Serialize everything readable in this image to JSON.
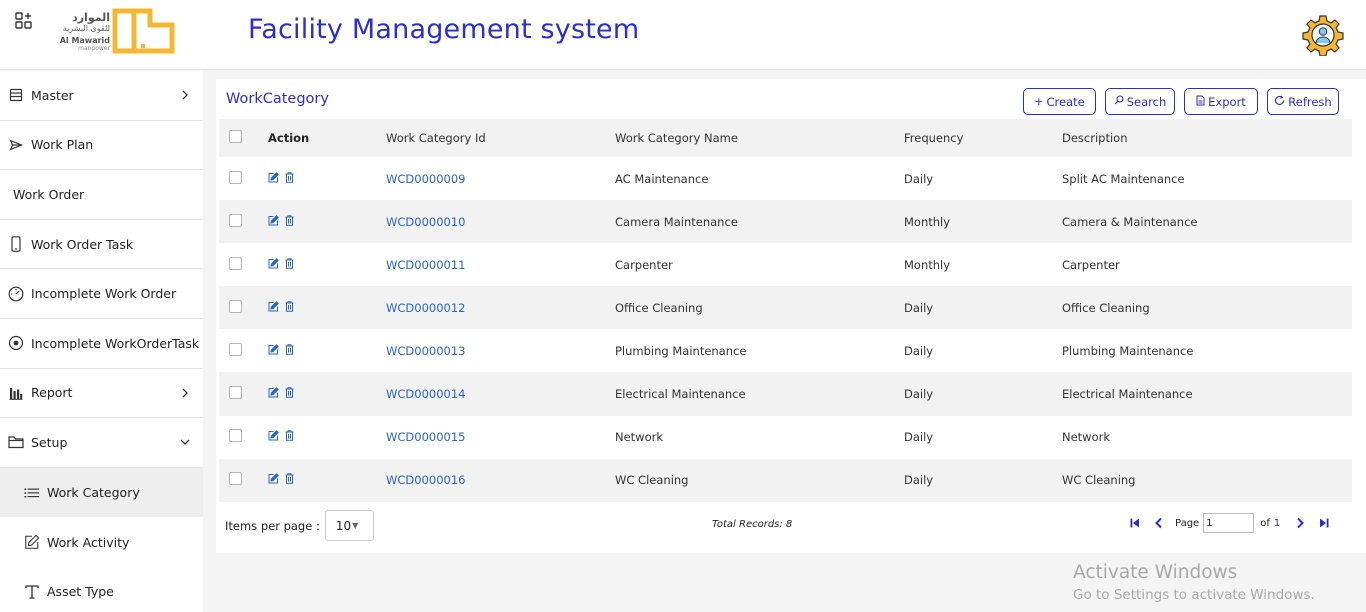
{
  "header": {
    "title": "Facility Management system",
    "logo": {
      "arabic_line1": "الموارد",
      "arabic_line2": "للقوى البشرية",
      "english": "Al Mawarid",
      "sub": "manpower"
    }
  },
  "sidebar": {
    "items": [
      {
        "label": "Master",
        "icon": "list-icon"
      },
      {
        "label": "Work Plan",
        "icon": "send-icon"
      },
      {
        "label": "Work Order"
      },
      {
        "label": "Work Order Task",
        "icon": "mobile-icon"
      },
      {
        "label": "Incomplete Work Order",
        "icon": "gauge-icon"
      },
      {
        "label": "Incomplete WorkOrderTask",
        "icon": "target-icon"
      },
      {
        "label": "Report",
        "icon": "bar-chart-icon"
      },
      {
        "label": "Setup",
        "icon": "folder-icon"
      },
      {
        "label": "Work Category",
        "icon": "list-bullets-icon"
      },
      {
        "label": "Work Activity",
        "icon": "edit-icon"
      },
      {
        "label": "Asset Type",
        "icon": "text-icon"
      }
    ]
  },
  "panel": {
    "title": "WorkCategory",
    "buttons": {
      "create": "Create",
      "search": "Search",
      "export": "Export",
      "refresh": "Refresh"
    }
  },
  "table": {
    "headers": {
      "action": "Action",
      "id": "Work Category Id",
      "name": "Work Category Name",
      "frequency": "Frequency",
      "description": "Description"
    },
    "rows": [
      {
        "id": "WCD0000009",
        "name": "AC Maintenance",
        "frequency": "Daily",
        "description": "Split AC Maintenance"
      },
      {
        "id": "WCD0000010",
        "name": "Camera Maintenance",
        "frequency": "Monthly",
        "description": "Camera & Maintenance"
      },
      {
        "id": "WCD0000011",
        "name": "Carpenter",
        "frequency": "Monthly",
        "description": "Carpenter"
      },
      {
        "id": "WCD0000012",
        "name": "Office Cleaning",
        "frequency": "Daily",
        "description": "Office Cleaning"
      },
      {
        "id": "WCD0000013",
        "name": "Plumbing Maintenance",
        "frequency": "Daily",
        "description": "Plumbing Maintenance"
      },
      {
        "id": "WCD0000014",
        "name": "Electrical Maintenance",
        "frequency": "Daily",
        "description": "Electrical Maintenance"
      },
      {
        "id": "WCD0000015",
        "name": "Network",
        "frequency": "Daily",
        "description": "Network"
      },
      {
        "id": "WCD0000016",
        "name": "WC Cleaning",
        "frequency": "Daily",
        "description": "WC Cleaning"
      }
    ]
  },
  "footer": {
    "items_per_page_label": "Items per page :",
    "items_per_page": "10",
    "total_records": "Total Records: 8",
    "page_label": "Page",
    "page_value": "1",
    "of_label": "of",
    "total_pages": "1"
  },
  "watermark": {
    "line1": "Activate Windows",
    "line2": "Go to Settings to activate Windows."
  },
  "colors": {
    "accent": "#2c2ecf",
    "link": "#2966c9",
    "logo": "#f5b731"
  }
}
